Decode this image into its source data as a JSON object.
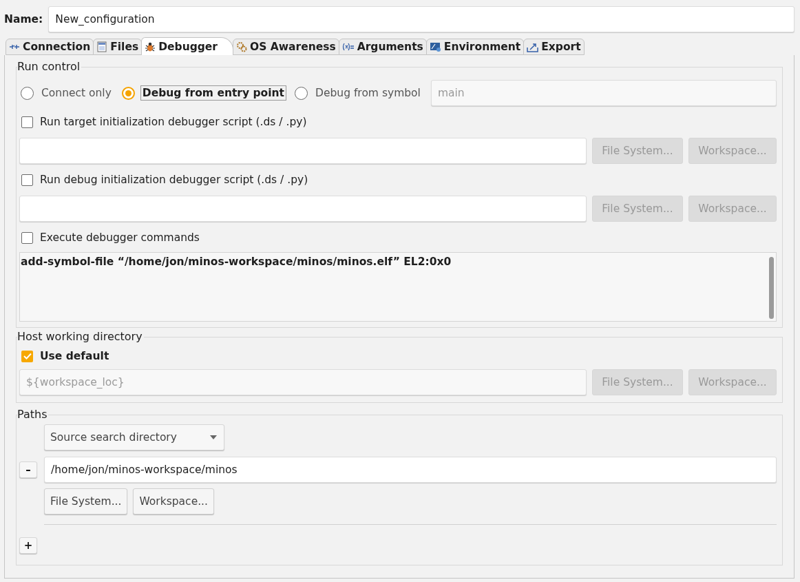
{
  "name": {
    "label": "Name:",
    "value": "New_configuration"
  },
  "tabs": [
    {
      "label": "Connection",
      "selected": false
    },
    {
      "label": "Files",
      "selected": false
    },
    {
      "label": "Debugger",
      "selected": true
    },
    {
      "label": "OS Awareness",
      "selected": false
    },
    {
      "label": "Arguments",
      "selected": false
    },
    {
      "label": "Environment",
      "selected": false
    },
    {
      "label": "Export",
      "selected": false
    }
  ],
  "run_control": {
    "title": "Run control",
    "modes": [
      {
        "label": "Connect only",
        "selected": false
      },
      {
        "label": "Debug from entry point",
        "selected": true
      },
      {
        "label": "Debug from symbol",
        "selected": false
      }
    ],
    "symbol_field": {
      "placeholder": "main",
      "disabled": true
    },
    "scripts": [
      {
        "label": "Run target initialization debugger script (.ds / .py)",
        "checked": false,
        "buttons": [
          {
            "label": "File System...",
            "disabled": true
          },
          {
            "label": "Workspace...",
            "disabled": true
          }
        ]
      },
      {
        "label": "Run debug initialization debugger script (.ds / .py)",
        "checked": false,
        "buttons": [
          {
            "label": "File System...",
            "disabled": true
          },
          {
            "label": "Workspace...",
            "disabled": true
          }
        ]
      }
    ],
    "commands": {
      "label": "Execute debugger commands",
      "checked": false,
      "text": "add-symbol-file “/home/jon/minos-workspace/minos/minos.elf” EL2:0x0"
    }
  },
  "host_dir": {
    "title": "Host working directory",
    "use_default": {
      "label": "Use default",
      "checked": true
    },
    "field": {
      "value": "${workspace_loc}",
      "disabled": true
    },
    "buttons": [
      {
        "label": "File System...",
        "disabled": true
      },
      {
        "label": "Workspace...",
        "disabled": true
      }
    ]
  },
  "paths": {
    "title": "Paths",
    "type_select": "Source search directory",
    "entries": [
      {
        "remove": "–",
        "value": "/home/jon/minos-workspace/minos",
        "buttons": [
          {
            "label": "File System...",
            "disabled": false
          },
          {
            "label": "Workspace...",
            "disabled": false
          }
        ]
      }
    ],
    "add": "+"
  }
}
